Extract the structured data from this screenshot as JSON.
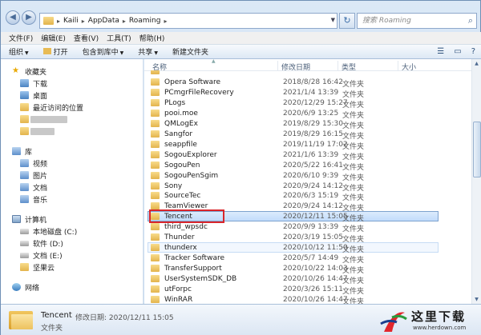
{
  "address": {
    "segments": [
      "Kaili",
      "AppData",
      "Roaming"
    ],
    "search_placeholder": "搜索 Roaming"
  },
  "menu": [
    "文件(F)",
    "编辑(E)",
    "查看(V)",
    "工具(T)",
    "帮助(H)"
  ],
  "toolbar": {
    "organize": "组织",
    "open": "打开",
    "include": "包含到库中",
    "share": "共享",
    "new_folder": "新建文件夹"
  },
  "nav": {
    "favorites": "收藏夹",
    "downloads": "下载",
    "desktop": "桌面",
    "recent": "最近访问的位置",
    "libraries": "库",
    "videos": "视频",
    "pictures": "图片",
    "documents": "文档",
    "music": "音乐",
    "computer": "计算机",
    "drive_c": "本地磁盘 (C:)",
    "drive_d": "软件 (D:)",
    "drive_e": "文档 (E:)",
    "jianguoyun": "坚果云",
    "network": "网络"
  },
  "columns": {
    "name": "名称",
    "modified": "修改日期",
    "type": "类型",
    "size": "大小"
  },
  "files": [
    {
      "name": "Opera Software",
      "date": "2018/8/28 16:42",
      "type": "文件夹"
    },
    {
      "name": "PCmgrFileRecovery",
      "date": "2021/1/4 13:39",
      "type": "文件夹"
    },
    {
      "name": "PLogs",
      "date": "2020/12/29 15:27",
      "type": "文件夹"
    },
    {
      "name": "pooi.moe",
      "date": "2020/6/9 13:25",
      "type": "文件夹"
    },
    {
      "name": "QMLogEx",
      "date": "2019/8/29 15:30",
      "type": "文件夹"
    },
    {
      "name": "Sangfor",
      "date": "2019/8/29 16:15",
      "type": "文件夹"
    },
    {
      "name": "seappfile",
      "date": "2019/11/19 17:02",
      "type": "文件夹"
    },
    {
      "name": "SogouExplorer",
      "date": "2021/1/6 13:39",
      "type": "文件夹"
    },
    {
      "name": "SogouPen",
      "date": "2020/5/22 16:41",
      "type": "文件夹"
    },
    {
      "name": "SogouPenSgim",
      "date": "2020/6/10 9:39",
      "type": "文件夹"
    },
    {
      "name": "Sony",
      "date": "2020/9/24 14:12",
      "type": "文件夹"
    },
    {
      "name": "SourceTec",
      "date": "2020/6/3 15:19",
      "type": "文件夹"
    },
    {
      "name": "TeamViewer",
      "date": "2020/9/24 14:12",
      "type": "文件夹"
    },
    {
      "name": "Tencent",
      "date": "2020/12/11 15:05",
      "type": "文件夹"
    },
    {
      "name": "third_wpsdc",
      "date": "2020/9/9 13:39",
      "type": "文件夹"
    },
    {
      "name": "Thunder",
      "date": "2020/3/19 15:05",
      "type": "文件夹"
    },
    {
      "name": "thunderx",
      "date": "2020/10/12 11:50",
      "type": "文件夹"
    },
    {
      "name": "Tracker Software",
      "date": "2020/5/7 14:49",
      "type": "文件夹"
    },
    {
      "name": "TransferSupport",
      "date": "2020/10/22 14:03",
      "type": "文件夹"
    },
    {
      "name": "UserSystemSDK_DB",
      "date": "2020/10/26 14:47",
      "type": "文件夹"
    },
    {
      "name": "utForpc",
      "date": "2020/3/26 15:11",
      "type": "文件夹"
    },
    {
      "name": "WinRAR",
      "date": "2020/10/26 14:47",
      "type": "文件夹"
    }
  ],
  "details": {
    "name": "Tencent",
    "meta": "修改日期: 2020/12/11 15:05",
    "type": "文件夹"
  },
  "watermark": {
    "text": "这里下载",
    "url": "www.herdown.com"
  }
}
